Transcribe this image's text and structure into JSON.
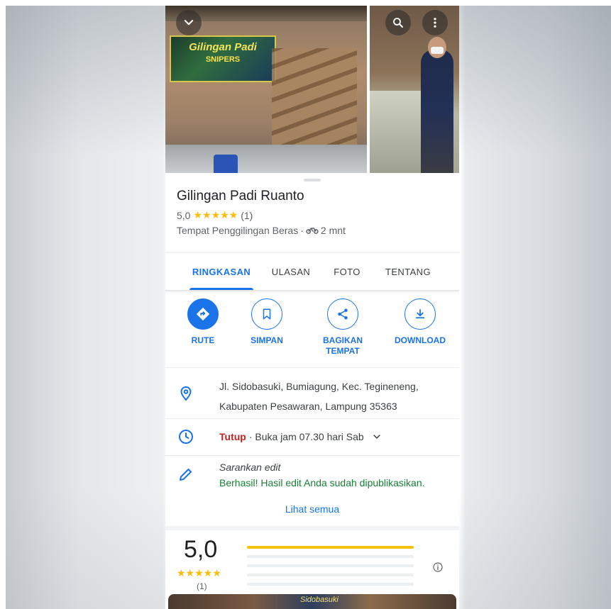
{
  "header": {
    "banner_title": "Gilingan Padi",
    "banner_subtitle": "SNIPERS"
  },
  "place": {
    "name": "Gilingan Padi Ruanto",
    "rating": "5,0",
    "stars": "★★★★★",
    "review_count": "(1)",
    "category": "Tempat Penggilingan Beras",
    "separator": "·",
    "travel_time": "2 mnt"
  },
  "tabs": [
    {
      "label": "RINGKASAN",
      "active": true
    },
    {
      "label": "ULASAN",
      "active": false
    },
    {
      "label": "FOTO",
      "active": false
    },
    {
      "label": "TENTANG",
      "active": false
    }
  ],
  "actions": [
    {
      "label": "RUTE",
      "icon": "directions-icon"
    },
    {
      "label": "SIMPAN",
      "icon": "bookmark-icon"
    },
    {
      "label": "BAGIKAN TEMPAT",
      "icon": "share-icon"
    },
    {
      "label": "DOWNLOAD",
      "icon": "download-icon"
    }
  ],
  "address": {
    "line1": "Jl. Sidobasuki, Bumiagung, Kec. Tegineneng,",
    "line2": "Kabupaten Pesawaran, Lampung 35363",
    "icon": "location-pin-icon"
  },
  "hours": {
    "status": "Tutup",
    "detail": "· Buka jam 07.30 hari Sab",
    "icon": "clock-icon"
  },
  "edit": {
    "title": "Sarankan edit",
    "message": "Berhasil! Hasil edit Anda sudah dipublikasikan.",
    "icon": "pencil-icon"
  },
  "see_all": "Lihat semua",
  "rating_summary": {
    "score": "5,0",
    "stars": "★★★★★",
    "count": "(1)",
    "distribution": [
      1.0,
      0.0,
      0.0,
      0.0,
      0.0
    ]
  },
  "bottom_photo": {
    "text": "Sidobasuki"
  },
  "colors": {
    "accent": "#1a73e8",
    "star": "#fbbc04",
    "closed": "#c5221f",
    "success": "#188038"
  }
}
